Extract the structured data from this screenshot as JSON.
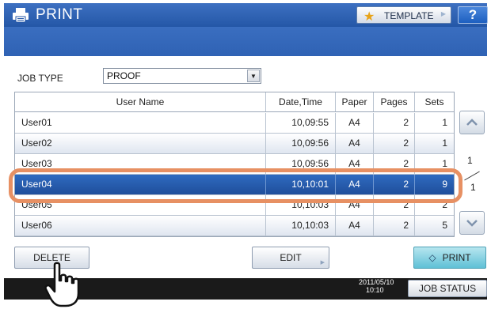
{
  "window": {
    "title": "PRINT",
    "template_button": "TEMPLATE",
    "help_button": "?"
  },
  "job_type": {
    "label": "JOB TYPE",
    "value": "PROOF"
  },
  "table": {
    "headers": [
      "User Name",
      "Date,Time",
      "Paper",
      "Pages",
      "Sets"
    ],
    "rows": [
      {
        "user": "User01",
        "datetime": "10,09:55",
        "paper": "A4",
        "pages": "2",
        "sets": "1"
      },
      {
        "user": "User02",
        "datetime": "10,09:56",
        "paper": "A4",
        "pages": "2",
        "sets": "1"
      },
      {
        "user": "User03",
        "datetime": "10,09:56",
        "paper": "A4",
        "pages": "2",
        "sets": "1"
      },
      {
        "user": "User04",
        "datetime": "10,10:01",
        "paper": "A4",
        "pages": "2",
        "sets": "9"
      },
      {
        "user": "User05",
        "datetime": "10,10:03",
        "paper": "A4",
        "pages": "2",
        "sets": "2"
      },
      {
        "user": "User06",
        "datetime": "10,10:03",
        "paper": "A4",
        "pages": "2",
        "sets": "5"
      }
    ],
    "selected_row_user": "User04"
  },
  "pagination": {
    "current": "1",
    "total": "1"
  },
  "buttons": {
    "delete": "DELETE",
    "edit": "EDIT",
    "print": "PRINT",
    "job_status": "JOB STATUS"
  },
  "status": {
    "date": "2011/05/10",
    "time": "10:10"
  },
  "icons": {
    "title": "printer-icon",
    "template": "star-icon",
    "scroll_up": "chevron-up-icon",
    "scroll_down": "chevron-down-icon",
    "print": "diamond-arrows-icon",
    "cursor": "hand-pointer-icon"
  },
  "colors": {
    "title_bar": "#2f62b4",
    "selected_row": "#1f4e9b",
    "highlight": "#e79063",
    "print_button": "#5fc0d6",
    "status_bar": "#1a1a1a"
  }
}
